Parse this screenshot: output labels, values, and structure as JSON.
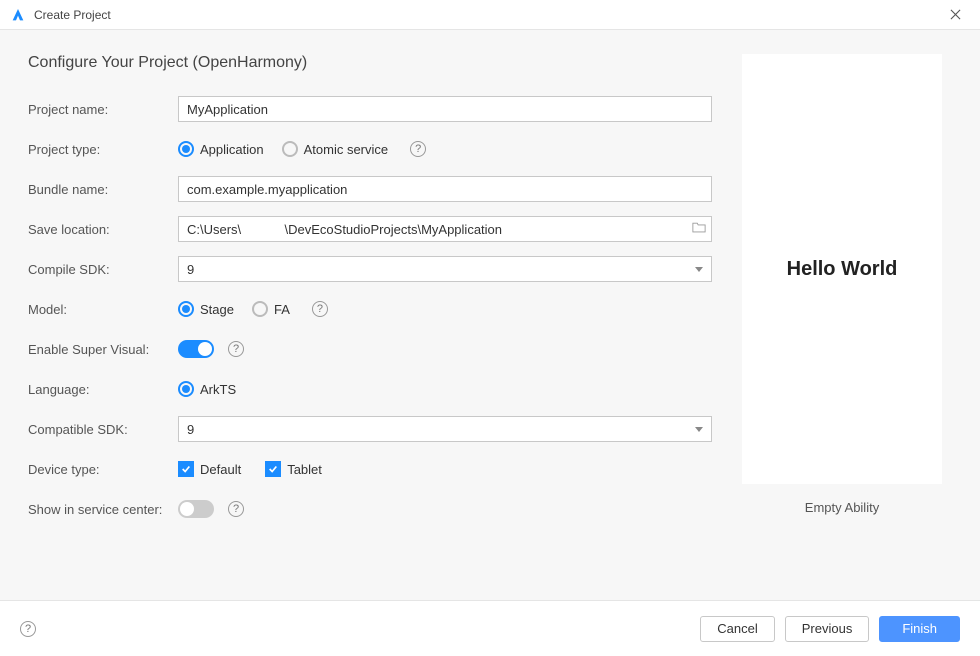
{
  "window": {
    "title": "Create Project"
  },
  "heading": "Configure Your Project (OpenHarmony)",
  "labels": {
    "project_name": "Project name:",
    "project_type": "Project type:",
    "bundle_name": "Bundle name:",
    "save_location": "Save location:",
    "compile_sdk": "Compile SDK:",
    "model": "Model:",
    "enable_super_visual": "Enable Super Visual:",
    "language": "Language:",
    "compatible_sdk": "Compatible SDK:",
    "device_type": "Device type:",
    "show_in_service_center": "Show in service center:"
  },
  "values": {
    "project_name": "MyApplication",
    "bundle_name": "com.example.myapplication",
    "save_location": "C:\\Users\\            \\DevEcoStudioProjects\\MyApplication",
    "compile_sdk": "9",
    "compatible_sdk": "9"
  },
  "project_type": {
    "options": [
      "Application",
      "Atomic service"
    ],
    "application": "Application",
    "atomic_service": "Atomic service",
    "selected": "Application"
  },
  "model": {
    "options": [
      "Stage",
      "FA"
    ],
    "stage": "Stage",
    "fa": "FA",
    "selected": "Stage"
  },
  "enable_super_visual": true,
  "language": {
    "options": [
      "ArkTS"
    ],
    "arkts": "ArkTS",
    "selected": "ArkTS"
  },
  "device_type": {
    "default_label": "Default",
    "tablet_label": "Tablet",
    "default_checked": true,
    "tablet_checked": true
  },
  "show_in_service_center": false,
  "preview": {
    "text": "Hello World",
    "template_name": "Empty Ability"
  },
  "footer": {
    "cancel": "Cancel",
    "previous": "Previous",
    "finish": "Finish"
  }
}
